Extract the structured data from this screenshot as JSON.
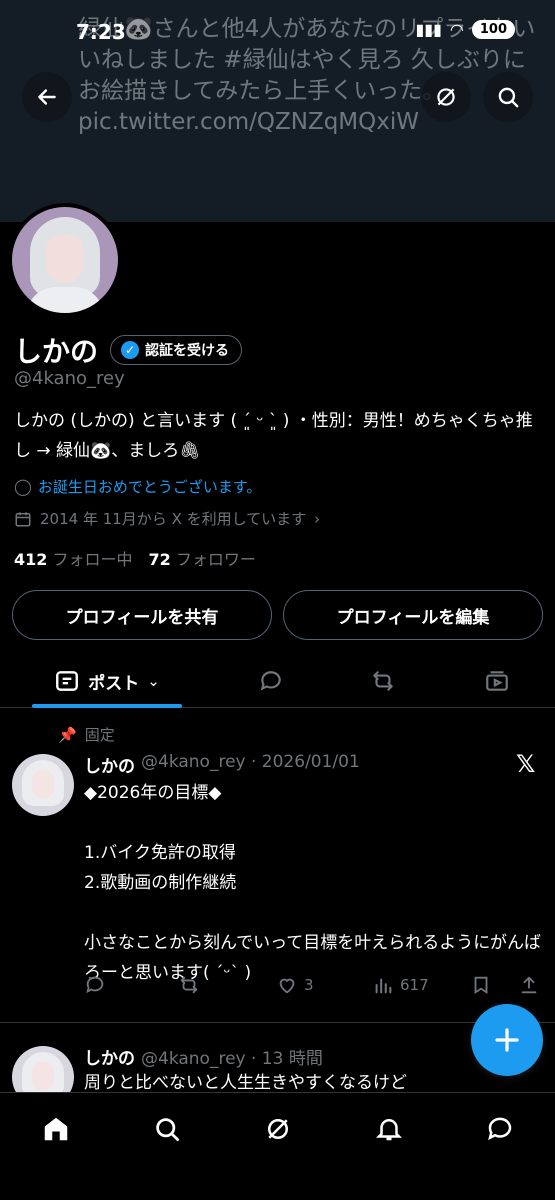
{
  "status": {
    "time": "7:23",
    "battery": "100"
  },
  "banner_text": "緑仙🐼さんと他4人があなたのリプライをいいねしました #緑仙はやく見ろ 久しぶりにお絵描きしてみたら上手くいった。 pic.twitter.com/QZNZqMQxiW",
  "profile": {
    "name": "しかの",
    "verify_label": "認証を受ける",
    "handle": "@4kano_rey",
    "bio": "しかの (しかの) と言います ( ˊ͈ ᵕ ˋ͈ ) ・性別：男性！めちゃくちゃ推し → 緑仙🐼、ましろ🖇",
    "birthday": "お誕生日おめでとうございます。",
    "joined": "2014 年 11月から X を利用しています",
    "following_count": "412",
    "following_label": "フォロー中",
    "followers_count": "72",
    "followers_label": "フォロワー",
    "share_button": "プロフィールを共有",
    "edit_button": "プロフィールを編集"
  },
  "tabs": {
    "active_label": "ポスト"
  },
  "posts": [
    {
      "pinned_label": "固定",
      "name": "しかの",
      "meta": "@4kano_rey · 2026/01/01",
      "body": "◆2026年の目標◆\n\n1.バイク免許の取得\n2.歌動画の制作継続\n\n小さなことから刻んでいって目標を叶えられるようにがんばろーと思います( ˊᵕˋ )",
      "likes": "3",
      "views": "617"
    },
    {
      "name": "しかの",
      "meta": "@4kano_rey · 13 時間",
      "body": "周りと比べないと人生生きやすくなるけど"
    }
  ],
  "colors": {
    "accent": "#1d9bf0",
    "background": "#000000",
    "muted": "#71767b"
  }
}
